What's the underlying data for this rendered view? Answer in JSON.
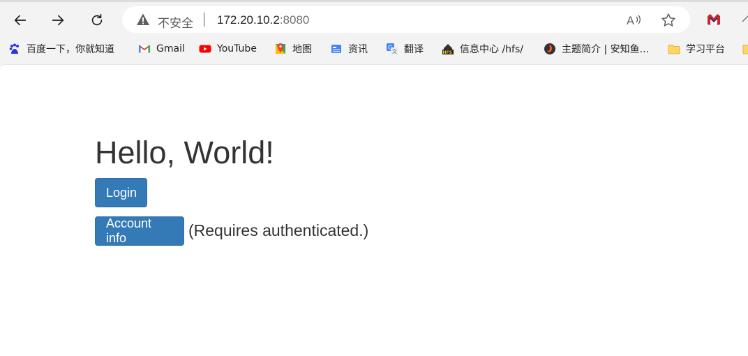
{
  "browser": {
    "security_label": "不安全",
    "url_host": "172.20.10.2",
    "url_port": ":8080",
    "icons": [
      "back-arrow-icon",
      "forward-arrow-icon",
      "reload-icon",
      "warning-icon",
      "read-aloud-icon",
      "favorite-star-icon",
      "extension-icon"
    ]
  },
  "bookmarks": [
    {
      "label": "百度一下，你就知道",
      "icon": "baidu-icon"
    },
    {
      "label": "Gmail",
      "icon": "gmail-icon"
    },
    {
      "label": "YouTube",
      "icon": "youtube-icon"
    },
    {
      "label": "地图",
      "icon": "maps-icon"
    },
    {
      "label": "资讯",
      "icon": "news-icon"
    },
    {
      "label": "翻译",
      "icon": "translate-icon"
    },
    {
      "label": "信息中心 /hfs/",
      "icon": "hfs-icon"
    },
    {
      "label": "主题简介 | 安知鱼...",
      "icon": "anzhiyu-icon"
    },
    {
      "label": "学习平台",
      "icon": "folder-icon"
    }
  ],
  "page": {
    "heading": "Hello, World!",
    "login_label": "Login",
    "account_label": "Account info",
    "account_note": "(Requires authenticated.)"
  },
  "colors": {
    "button": "#337ab7",
    "text": "#333333"
  }
}
